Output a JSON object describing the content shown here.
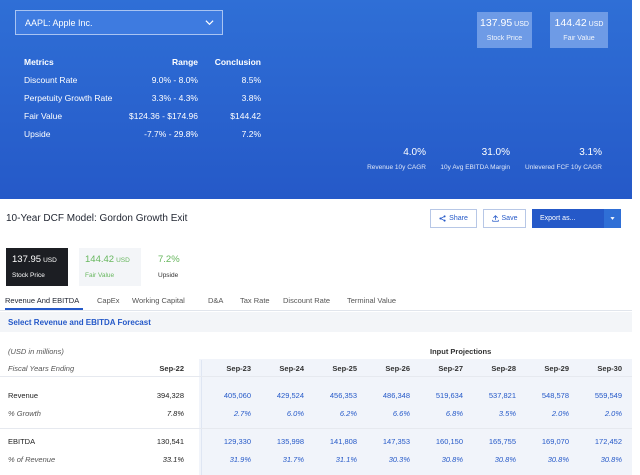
{
  "ticker": {
    "label": "AAPL: Apple Inc."
  },
  "header_boxes": {
    "stock_price": {
      "value": "137.95",
      "unit": "USD",
      "label": "Stock Price"
    },
    "fair_value": {
      "value": "144.42",
      "unit": "USD",
      "label": "Fair Value"
    }
  },
  "metrics": {
    "headers": {
      "metric": "Metrics",
      "range": "Range",
      "conclusion": "Conclusion"
    },
    "rows": [
      {
        "name": "Discount Rate",
        "range": "9.0% - 8.0%",
        "conclusion": "8.5%"
      },
      {
        "name": "Perpetuity Growth Rate",
        "range": "3.3% - 4.3%",
        "conclusion": "3.8%"
      },
      {
        "name": "Fair Value",
        "range": "$124.36 - $174.96",
        "conclusion": "$144.42"
      },
      {
        "name": "Upside",
        "range": "-7.7% - 29.8%",
        "conclusion": "7.2%"
      }
    ]
  },
  "stats": [
    {
      "value": "4.0%",
      "label": "Revenue 10y CAGR"
    },
    {
      "value": "31.0%",
      "label": "10y Avg EBITDA Margin"
    },
    {
      "value": "3.1%",
      "label": "Unlevered FCF 10y CAGR"
    }
  ],
  "model": {
    "title": "10-Year DCF Model: Gordon Growth Exit",
    "share_label": "Share",
    "save_label": "Save",
    "export_label": "Export as..."
  },
  "cards": {
    "stock_price": {
      "value": "137.95",
      "unit": "USD",
      "label": "Stock Price"
    },
    "fair_value": {
      "value": "144.42",
      "unit": "USD",
      "label": "Fair Value"
    },
    "upside": {
      "value": "7.2%",
      "label": "Upside"
    }
  },
  "tabs": [
    "Revenue And EBITDA",
    "CapEx",
    "Working Capital",
    "D&A",
    "Tax Rate",
    "Discount Rate",
    "Terminal Value"
  ],
  "section_title": "Select Revenue and EBITDA Forecast",
  "table": {
    "units": "(USD in millions)",
    "input_projections": "Input Projections",
    "fiscal_label": "Fiscal Years Ending",
    "years": [
      "Sep-22",
      "Sep-23",
      "Sep-24",
      "Sep-25",
      "Sep-26",
      "Sep-27",
      "Sep-28",
      "Sep-29",
      "Sep-30"
    ],
    "rows": [
      {
        "label": "Revenue",
        "italic": false,
        "values": [
          "394,328",
          "405,060",
          "429,524",
          "456,353",
          "486,348",
          "519,634",
          "537,821",
          "548,578",
          "559,549"
        ]
      },
      {
        "label": "% Growth",
        "italic": true,
        "values": [
          "7.8%",
          "2.7%",
          "6.0%",
          "6.2%",
          "6.6%",
          "6.8%",
          "3.5%",
          "2.0%",
          "2.0%"
        ]
      },
      {
        "label": "EBITDA",
        "italic": false,
        "values": [
          "130,541",
          "129,330",
          "135,998",
          "141,808",
          "147,353",
          "160,150",
          "165,755",
          "169,070",
          "172,452"
        ]
      },
      {
        "label": "% of Revenue",
        "italic": true,
        "values": [
          "33.1%",
          "31.9%",
          "31.7%",
          "31.1%",
          "30.3%",
          "30.8%",
          "30.8%",
          "30.8%",
          "30.8%"
        ]
      }
    ]
  }
}
